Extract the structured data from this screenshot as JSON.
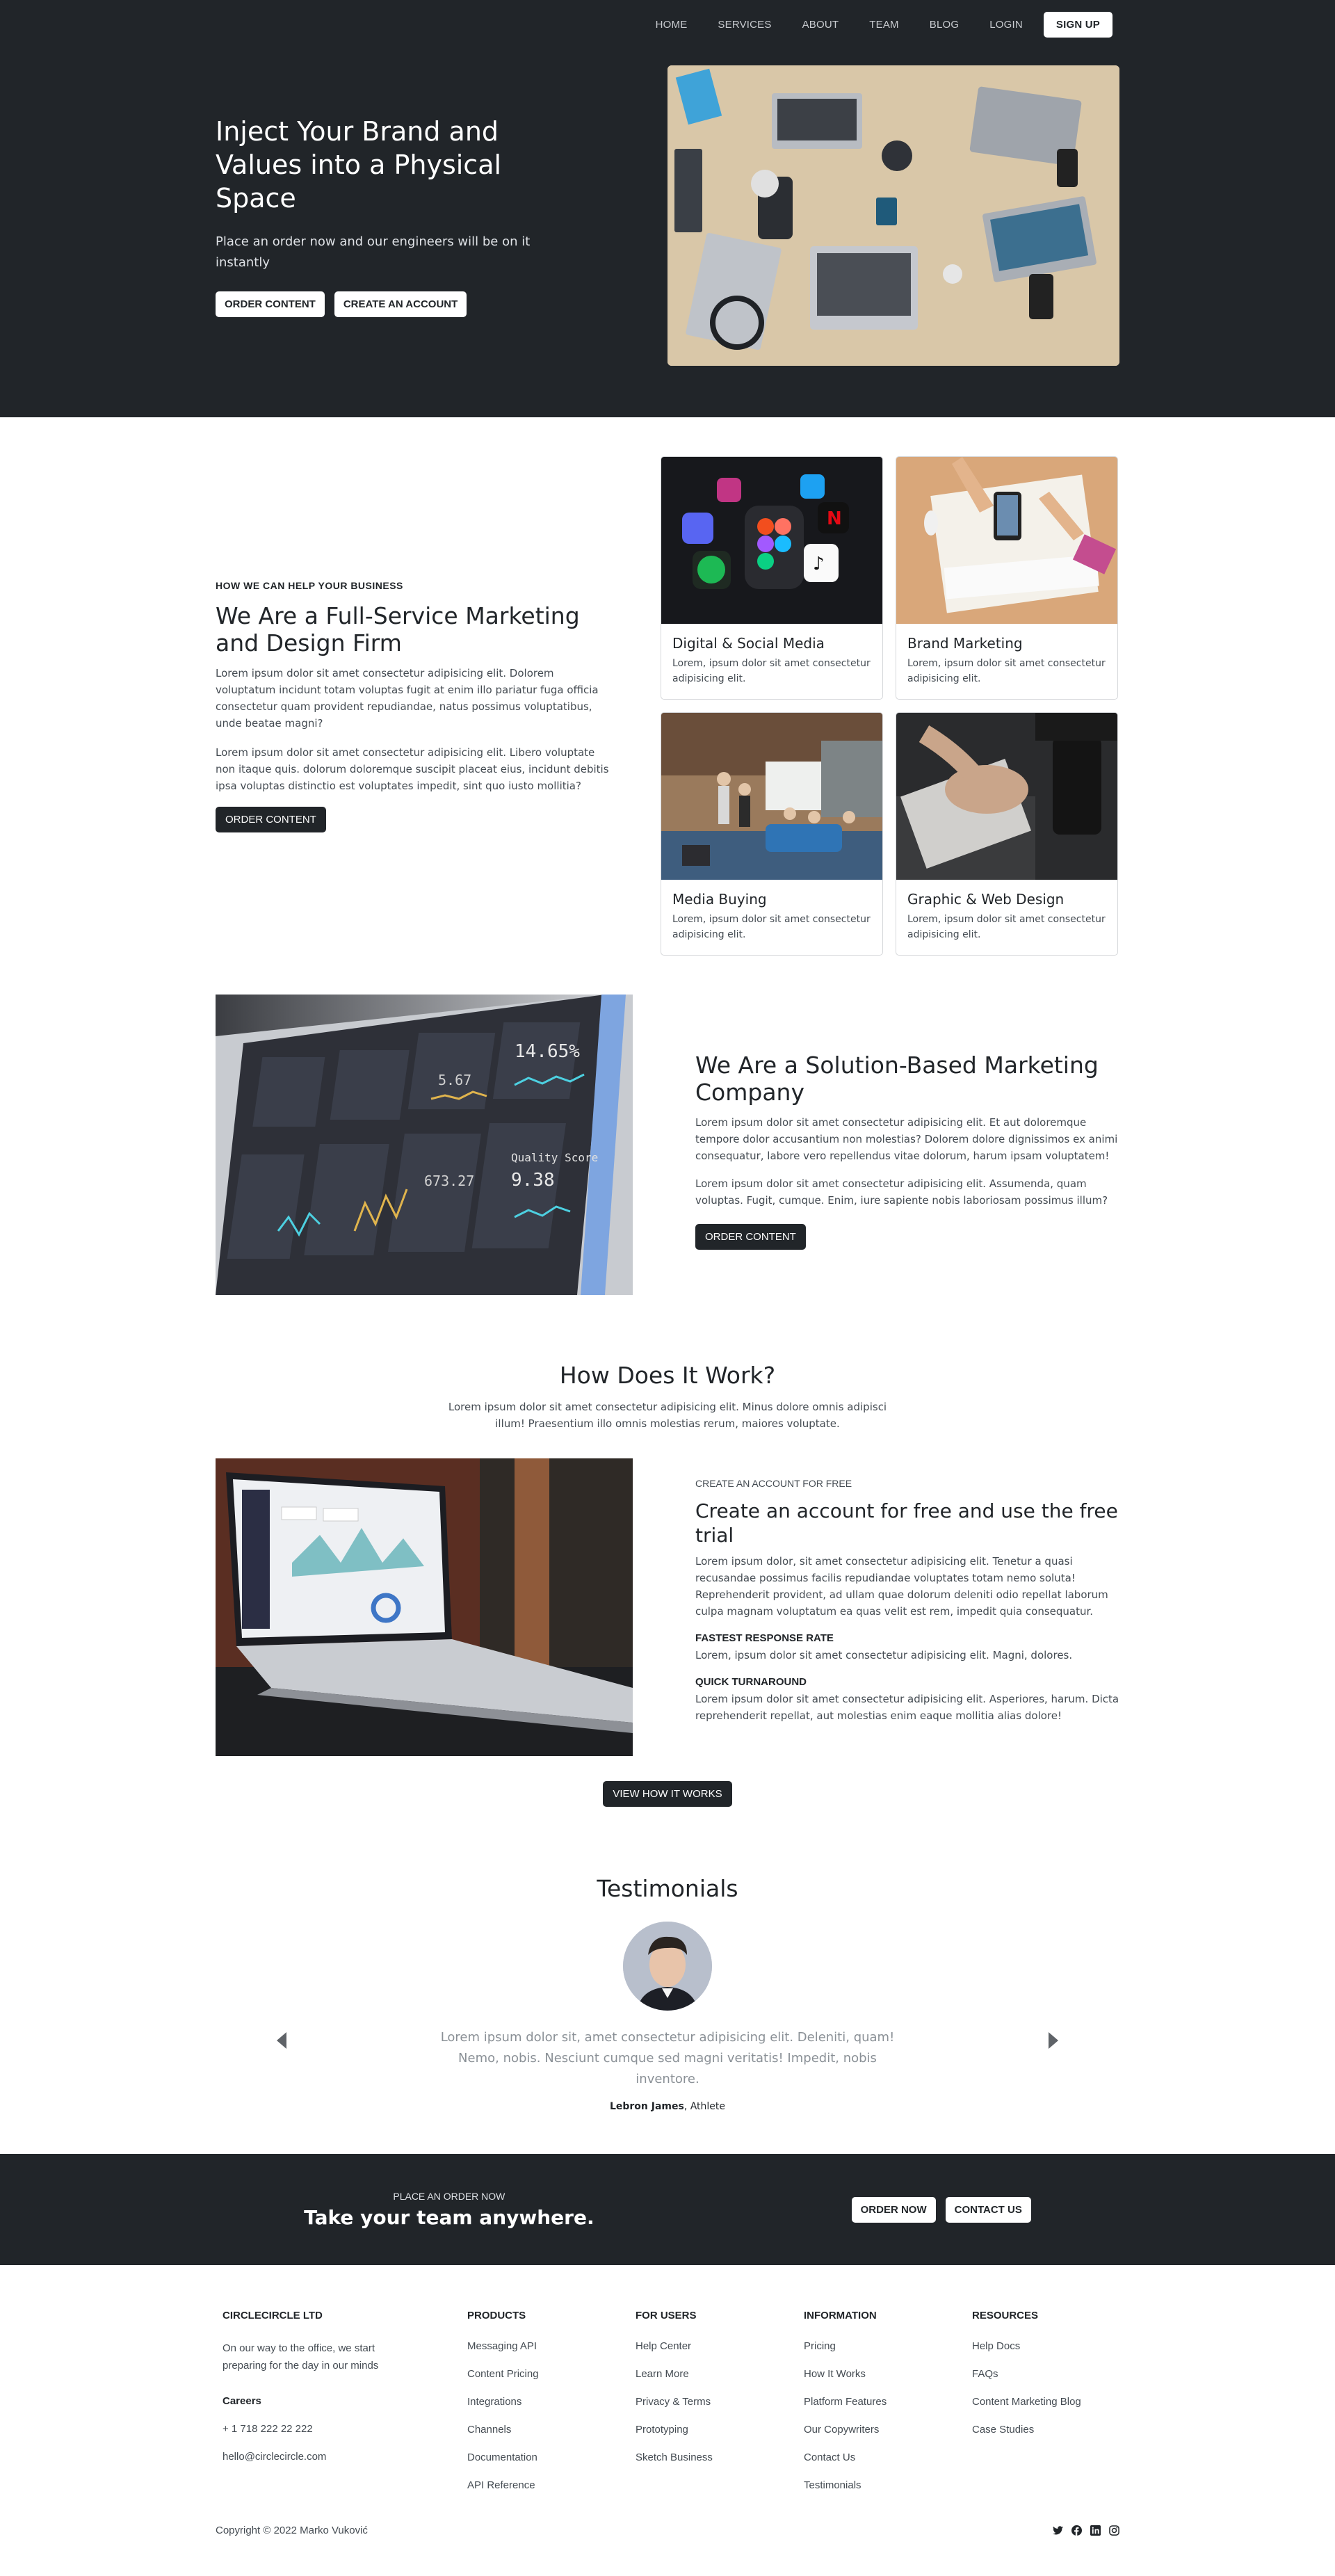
{
  "nav": {
    "items": [
      "HOME",
      "SERVICES",
      "ABOUT",
      "TEAM",
      "BLOG",
      "LOGIN"
    ],
    "signup": "SIGN UP"
  },
  "hero": {
    "title": "Inject Your Brand and Values into a Physical Space",
    "text": "Place an order now and our engineers will be on it instantly",
    "btn_order": "ORDER CONTENT",
    "btn_account": "CREATE AN ACCOUNT"
  },
  "services": {
    "eyebrow": "HOW WE CAN HELP YOUR BUSINESS",
    "title": "We Are a Full-Service Marketing and Design Firm",
    "p1": "Lorem ipsum dolor sit amet consectetur adipisicing elit. Dolorem voluptatum incidunt totam voluptas fugit at enim illo pariatur fuga officia consectetur quam provident repudiandae, natus possimus voluptatibus, unde beatae magni?",
    "p2": "Lorem ipsum dolor sit amet consectetur adipisicing elit. Libero voluptate non itaque quis. dolorum doloremque suscipit placeat eius, incidunt debitis ipsa voluptas distinctio est voluptates impedit, sint quo iusto mollitia?",
    "btn": "ORDER CONTENT",
    "cards": [
      {
        "title": "Digital & Social Media",
        "text": "Lorem, ipsum dolor sit amet consectetur adipisicing elit."
      },
      {
        "title": "Brand Marketing",
        "text": "Lorem, ipsum dolor sit amet consectetur adipisicing elit."
      },
      {
        "title": "Media Buying",
        "text": "Lorem, ipsum dolor sit amet consectetur adipisicing elit."
      },
      {
        "title": "Graphic & Web Design",
        "text": "Lorem, ipsum dolor sit amet consectetur adipisicing elit."
      }
    ]
  },
  "solution": {
    "title": "We Are a Solution-Based Marketing Company",
    "p1": "Lorem ipsum dolor sit amet consectetur adipisicing elit. Et aut doloremque tempore dolor accusantium non molestias? Dolorem dolore dignissimos ex animi consequatur, labore vero repellendus vitae dolorum, harum ipsam voluptatem!",
    "p2": "Lorem ipsum dolor sit amet consectetur adipisicing elit. Assumenda, quam voluptas. Fugit, cumque. Enim, iure sapiente nobis laboriosam possimus illum?",
    "btn": "ORDER CONTENT",
    "screen_texts": [
      "14.65%",
      "Quality Score",
      "9.38",
      "673.27",
      "5.67"
    ]
  },
  "how": {
    "title": "How Does It Work?",
    "subtitle": "Lorem ipsum dolor sit amet consectetur adipisicing elit. Minus dolore omnis adipisci illum! Praesentium illo omnis molestias rerum, maiores voluptate.",
    "eyebrow": "CREATE AN ACCOUNT FOR FREE",
    "heading": "Create an account for free and use the free trial",
    "p1": "Lorem ipsum dolor, sit amet consectetur adipisicing elit. Tenetur a quasi recusandae possimus facilis repudiandae voluptates totam nemo soluta! Reprehenderit provident, ad ullam quae dolorum deleniti odio repellat laborum culpa magnam voluptatum ea quas velit est rem, impedit quia consequatur.",
    "f1_title": "FASTEST RESPONSE RATE",
    "f1_text": "Lorem, ipsum dolor sit amet consectetur adipisicing elit. Magni, dolores.",
    "f2_title": "QUICK TURNAROUND",
    "f2_text": "Lorem ipsum dolor sit amet consectetur adipisicing elit. Asperiores, harum. Dicta reprehenderit repellat, aut molestias enim eaque mollitia alias dolore!",
    "btn": "VIEW HOW IT WORKS"
  },
  "testimonials": {
    "title": "Testimonials",
    "quote": "Lorem ipsum dolor sit, amet consectetur adipisicing elit. Deleniti, quam! Nemo, nobis. Nesciunt cumque sed magni veritatis! Impedit, nobis inventore.",
    "name": "Lebron James",
    "role": ", Athlete"
  },
  "cta": {
    "small": "PLACE AN ORDER NOW",
    "title": "Take your team anywhere.",
    "btn_order": "ORDER NOW",
    "btn_contact": "CONTACT US"
  },
  "footer": {
    "company": "CIRCLECIRCLE LTD",
    "tagline": "On our way to the office, we start preparing for the day in our minds",
    "careers": "Careers",
    "phone": "+ 1 718 222 22 222",
    "email": "hello@circlecircle.com",
    "columns": [
      {
        "title": "PRODUCTS",
        "links": [
          "Messaging API",
          "Content Pricing",
          "Integrations",
          "Channels",
          "Documentation",
          "API Reference"
        ]
      },
      {
        "title": "FOR USERS",
        "links": [
          "Help Center",
          "Learn More",
          "Privacy & Terms",
          "Prototyping",
          "Sketch Business"
        ]
      },
      {
        "title": "INFORMATION",
        "links": [
          "Pricing",
          "How It Works",
          "Platform Features",
          "Our Copywriters",
          "Contact Us",
          "Testimonials"
        ]
      },
      {
        "title": "RESOURCES",
        "links": [
          "Help Docs",
          "FAQs",
          "Content Marketing Blog",
          "Case Studies"
        ]
      }
    ],
    "copyright": "Copyright © 2022 Marko Vuković",
    "social_icons": [
      "twitter-icon",
      "facebook-icon",
      "linkedin-icon",
      "instagram-icon"
    ]
  },
  "colors": {
    "dark": "#212529",
    "text": "#444b52",
    "light": "#ffffff"
  }
}
